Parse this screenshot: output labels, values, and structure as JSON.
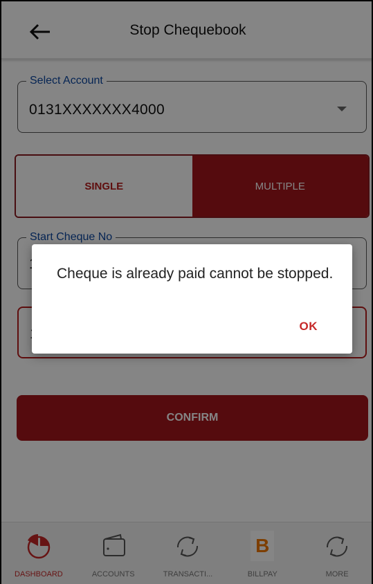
{
  "header": {
    "title": "Stop Chequebook"
  },
  "account": {
    "label": "Select Account",
    "value": "0131XXXXXXX4000"
  },
  "toggle": {
    "single": "SINGLE",
    "multiple": "MULTIPLE"
  },
  "fields": {
    "start_label": "Start Cheque No",
    "start_value": "1",
    "end_value": "1"
  },
  "confirm_label": "CONFIRM",
  "dialog": {
    "message": "Cheque is already paid cannot be stopped.",
    "ok_label": "OK"
  },
  "nav": {
    "items": [
      {
        "label": "DASHBOARD",
        "icon": "dashboard-pie-icon",
        "active": true
      },
      {
        "label": "ACCOUNTS",
        "icon": "wallet-icon"
      },
      {
        "label": "TRANSACTI...",
        "icon": "transfer-arrows-icon"
      },
      {
        "label": "BILLPAY",
        "icon": "billpay-b-logo",
        "logo_letter": "B"
      },
      {
        "label": "MORE",
        "icon": "more-arrows-icon"
      }
    ]
  },
  "colors": {
    "brand": "#a3161c",
    "accent_red": "#c62828",
    "label_blue": "#0d47a1",
    "billpay_orange": "#f07800"
  }
}
